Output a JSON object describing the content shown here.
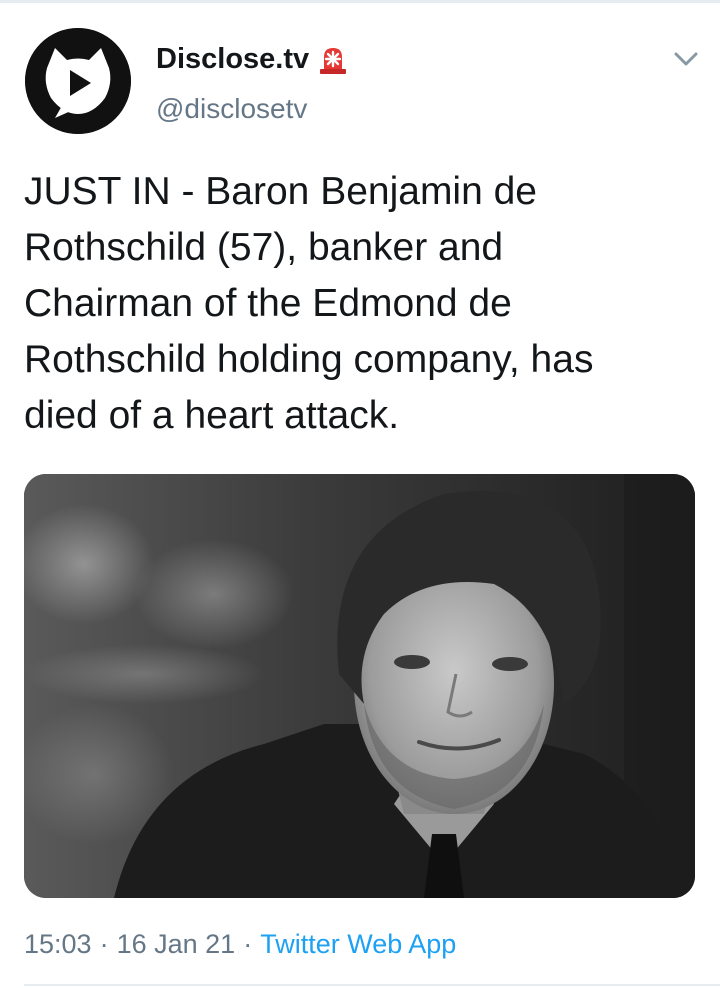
{
  "tweet": {
    "author": {
      "display_name": "Disclose.tv",
      "handle": "@disclosetv",
      "avatar_icon": "play-cat-logo-icon",
      "badge_icon": "siren-emoji-icon"
    },
    "menu_icon": "chevron-down-icon",
    "text": "JUST IN - Baron Benjamin de\nRothschild (57), banker and\nChairman of the Edmond de\nRothschild holding company, has\ndied of a heart attack.",
    "media": {
      "kind": "photo",
      "style": "black-and-white portrait"
    },
    "time": "15:03",
    "separator": "·",
    "date": "16 Jan 21",
    "source": "Twitter Web App"
  },
  "colors": {
    "text": "#14171a",
    "secondary": "#657786",
    "link": "#1da1f2",
    "divider": "#e6ecf0"
  }
}
